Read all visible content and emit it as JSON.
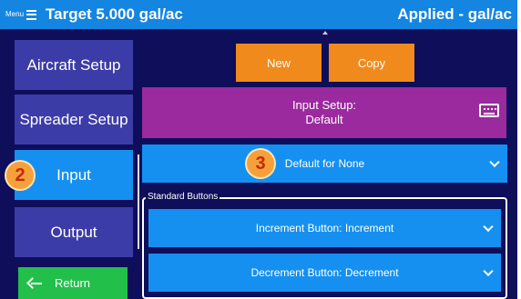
{
  "header": {
    "menu_label": "Menu",
    "title": "Target 5.000 gal/ac",
    "applied": "Applied - gal/ac"
  },
  "sidebar": {
    "items": [
      {
        "label": "Aircraft Setup"
      },
      {
        "label": "Spreader Setup"
      },
      {
        "label": "Input"
      },
      {
        "label": "Output"
      }
    ],
    "return_label": "Return"
  },
  "actions": {
    "new_label": "New",
    "copy_label": "Copy"
  },
  "input_setup": {
    "line1": "Input Setup:",
    "line2": "Default",
    "icon": "keyboard-icon"
  },
  "default_dropdown": {
    "value": "Default for None"
  },
  "standard_buttons": {
    "group_label": "Standard Buttons",
    "increment": "Increment Button: Increment",
    "decrement": "Decrement Button: Decrement"
  },
  "annotations": {
    "badge_2": "2",
    "badge_3": "3"
  },
  "colors": {
    "background": "#0e0e5a",
    "topbar": "#1485e0",
    "sidebar_button": "#3c3ca8",
    "active_button": "#1590f0",
    "orange": "#f08a1c",
    "purple": "#9a2a9e",
    "green": "#22c04a",
    "badge": "#f6a03a"
  }
}
